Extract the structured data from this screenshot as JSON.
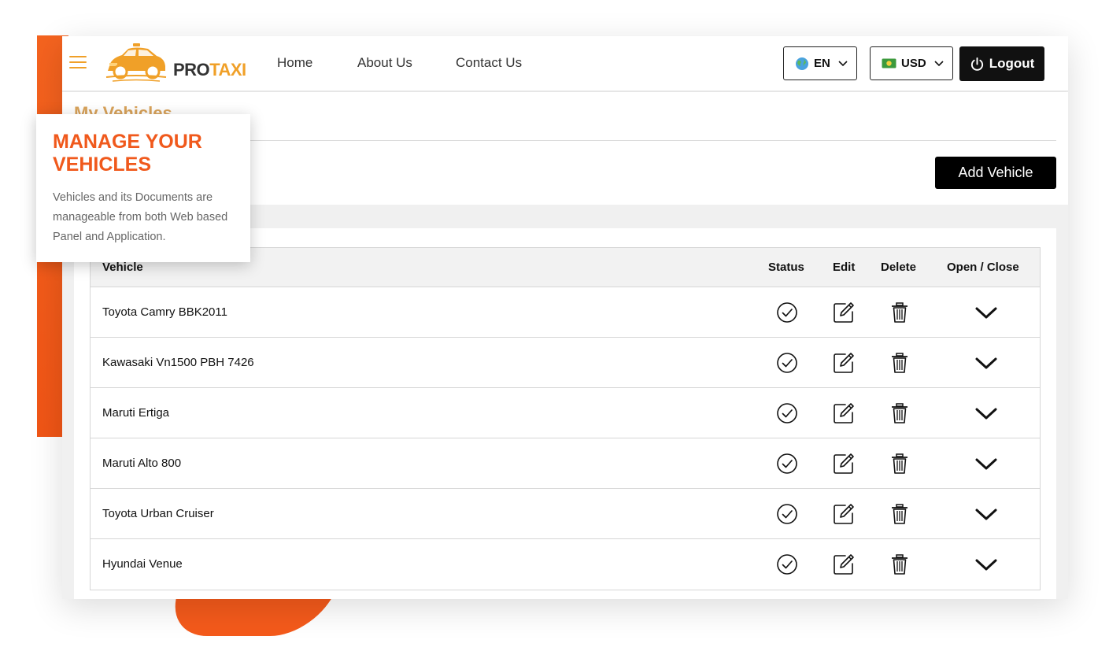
{
  "header": {
    "brand_pro": "PRO",
    "brand_taxi": "TAXI",
    "nav": [
      "Home",
      "About Us",
      "Contact Us"
    ],
    "language": "EN",
    "currency": "USD",
    "logout_label": "Logout"
  },
  "page": {
    "title": "My Vehicles",
    "add_vehicle_label": "Add Vehicle"
  },
  "table": {
    "headers": {
      "vehicle": "Vehicle",
      "status": "Status",
      "edit": "Edit",
      "delete": "Delete",
      "open_close": "Open / Close"
    },
    "rows": [
      "Toyota Camry BBK2011",
      "Kawasaki Vn1500 PBH 7426",
      "Maruti Ertiga",
      "Maruti Alto 800",
      "Toyota Urban Cruiser",
      "Hyundai Venue"
    ]
  },
  "callout": {
    "title": "MANAGE YOUR VEHICLES",
    "description": "Vehicles and its Documents are manageable from both Web based Panel and Application."
  },
  "colors": {
    "accent": "#f0a028",
    "callout_title": "#f0591c",
    "deco": "#f45a1b"
  },
  "icons": [
    "menu-icon",
    "globe-icon",
    "banknote-icon",
    "chevron-down-icon",
    "power-icon",
    "check-circle-icon",
    "edit-icon",
    "trash-icon"
  ]
}
